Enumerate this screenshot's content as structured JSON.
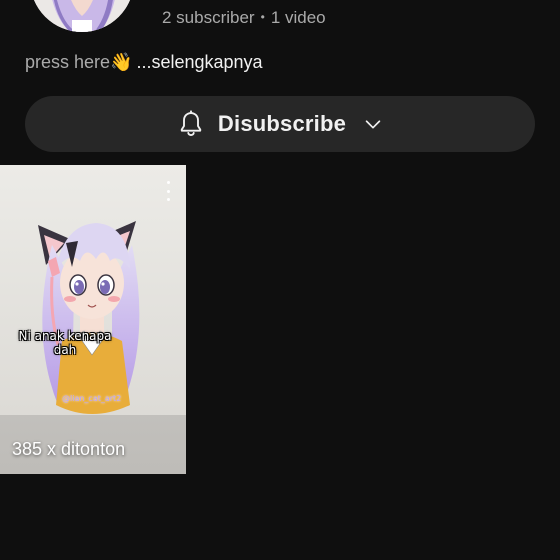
{
  "channel": {
    "subscribers": "2 subscriber",
    "separator": "•",
    "videos": "1 video",
    "description": "press here👋",
    "description_more": "...selengkapnya"
  },
  "subscribe_button": {
    "label": "Disubscribe",
    "icon": "bell-icon",
    "dropdown_icon": "chevron-down-icon"
  },
  "shorts": [
    {
      "caption": "Ni anak kenapa dah",
      "watermark": "@lian_cat_art2",
      "views": "385 x ditonton",
      "menu_icon": "more-vert-icon"
    }
  ],
  "colors": {
    "background": "#0f0f0f",
    "button_bg": "#272727",
    "secondary_text": "#aaaaaa",
    "primary_text": "#f1f1f1"
  }
}
